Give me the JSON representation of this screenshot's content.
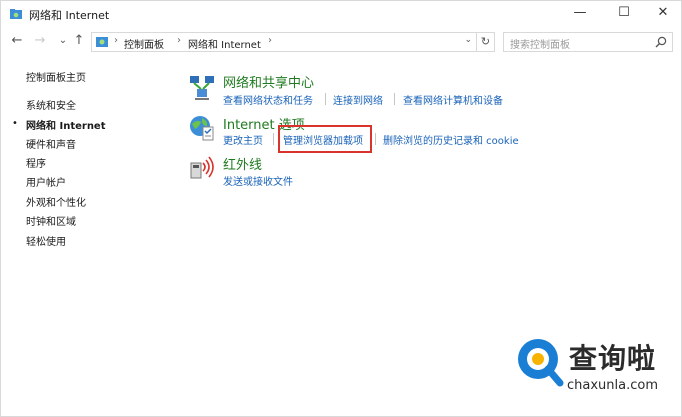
{
  "window": {
    "title": "网络和 Internet",
    "controls": {
      "minimize": "—",
      "maximize": "☐",
      "close": "✕"
    }
  },
  "nav": {
    "back": "←",
    "forward": "→",
    "recent": "⌄",
    "up": "↑",
    "breadcrumbs": [
      "控制面板",
      "网络和 Internet"
    ],
    "separator": "›",
    "dropdown": "⌄",
    "refresh": "↻",
    "search_placeholder": "搜索控制面板"
  },
  "sidebar": {
    "home": "控制面板主页",
    "items": [
      {
        "label": "系统和安全",
        "active": false
      },
      {
        "label": "网络和 Internet",
        "active": true
      },
      {
        "label": "硬件和声音",
        "active": false
      },
      {
        "label": "程序",
        "active": false
      },
      {
        "label": "用户帐户",
        "active": false
      },
      {
        "label": "外观和个性化",
        "active": false
      },
      {
        "label": "时钟和区域",
        "active": false
      },
      {
        "label": "轻松使用",
        "active": false
      }
    ],
    "active_marker": "•"
  },
  "main": {
    "categories": [
      {
        "title": "网络和共享中心",
        "icon": "network-sharing-icon",
        "links": [
          "查看网络状态和任务",
          "连接到网络",
          "查看网络计算机和设备"
        ]
      },
      {
        "title": "Internet 选项",
        "icon": "internet-options-icon",
        "links": [
          "更改主页",
          "管理浏览器加载项",
          "删除浏览的历史记录和 cookie"
        ],
        "highlighted_link": "管理浏览器加载项"
      },
      {
        "title": "红外线",
        "icon": "infrared-icon",
        "links": [
          "发送或接收文件"
        ]
      }
    ]
  },
  "watermark": {
    "name": "查询啦",
    "url": "chaxunla.com"
  },
  "colors": {
    "link": "#1a63b8",
    "category_title": "#1f7a1f",
    "highlight_border": "#d9342b",
    "watermark_blue": "#1a7fd4"
  }
}
